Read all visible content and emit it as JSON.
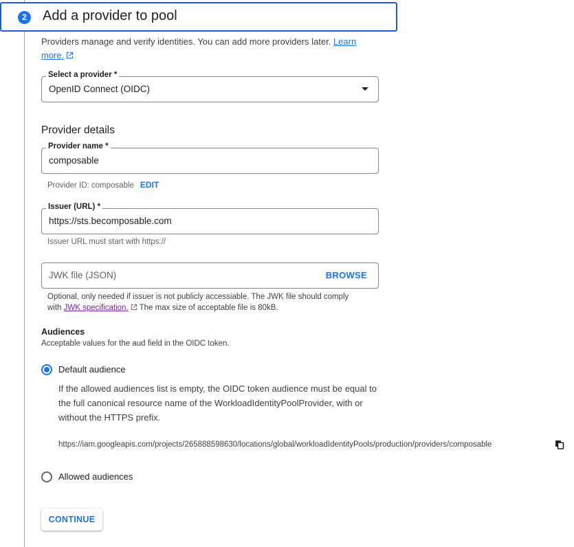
{
  "step": {
    "number": "2",
    "title": "Add a provider to pool",
    "description": "Providers manage and verify identities. You can add more providers later.",
    "learn_more": "Learn more."
  },
  "provider_select": {
    "label": "Select a provider *",
    "value": "OpenID Connect (OIDC)"
  },
  "provider_details": {
    "heading": "Provider details",
    "name_label": "Provider name *",
    "name_value": "composable",
    "id_text": "Provider ID: composable",
    "edit_label": "EDIT",
    "issuer_label": "Issuer (URL) *",
    "issuer_value": "https://sts.becomposable.com",
    "issuer_helper": "Issuer URL must start with https://",
    "jwk_placeholder": "JWK file (JSON)",
    "browse_label": "BROWSE",
    "jwk_help_before": "Optional, only needed if issuer is not publicly accessiable. The JWK file should comply with",
    "jwk_link": "JWK specification.",
    "jwk_help_after": "The max size of acceptable file is 80kB."
  },
  "audiences": {
    "title": "Audiences",
    "description": "Acceptable values for the aud field in the OIDC token.",
    "default_label": "Default audience",
    "default_explain": "If the allowed audiences list is empty, the OIDC token audience must be equal to the full canonical resource name of the WorkloadIdentityPoolProvider, with or without the HTTPS prefix.",
    "default_url": "https://iam.googleapis.com/projects/265888598630/locations/global/workloadIdentityPools/production/providers/composable",
    "allowed_label": "Allowed audiences",
    "selected": "default"
  },
  "continue_label": "CONTINUE",
  "colors": {
    "accent": "#1a73e8",
    "header_border": "#1a5bd6",
    "visited_link": "#7b1fa2"
  }
}
